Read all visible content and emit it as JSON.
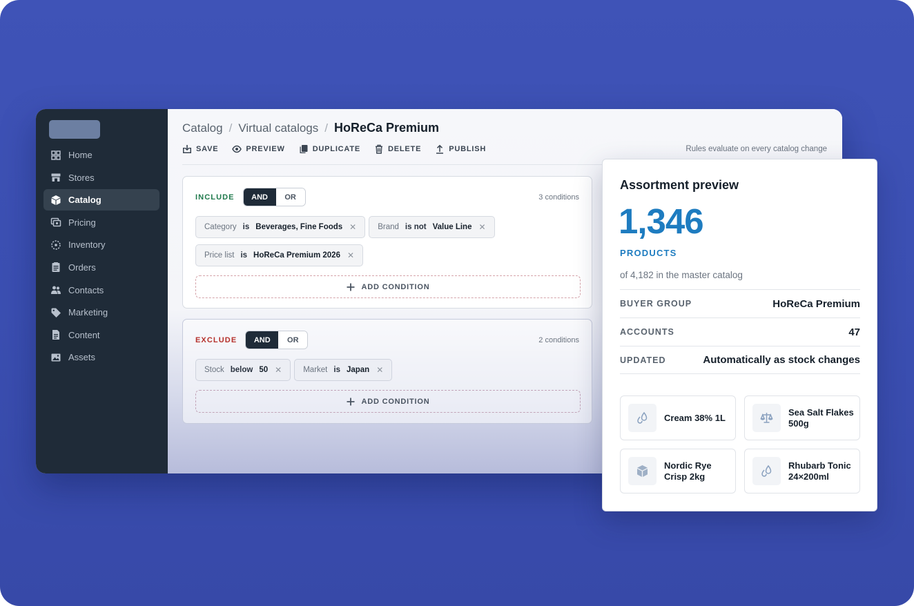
{
  "sidebar": {
    "items": [
      {
        "label": "Home",
        "icon": "grid-icon"
      },
      {
        "label": "Stores",
        "icon": "store-icon"
      },
      {
        "label": "Catalog",
        "icon": "box-icon",
        "active": true
      },
      {
        "label": "Pricing",
        "icon": "pricing-icon"
      },
      {
        "label": "Inventory",
        "icon": "inventory-icon"
      },
      {
        "label": "Orders",
        "icon": "clipboard-icon"
      },
      {
        "label": "Contacts",
        "icon": "people-icon"
      },
      {
        "label": "Marketing",
        "icon": "tag-icon"
      },
      {
        "label": "Content",
        "icon": "document-icon"
      },
      {
        "label": "Assets",
        "icon": "image-icon"
      }
    ]
  },
  "breadcrumb": {
    "root": "Catalog",
    "parent": "Virtual catalogs",
    "current": "HoReCa Premium"
  },
  "toolbar": {
    "save": "SAVE",
    "preview": "PREVIEW",
    "duplicate": "DUPLICATE",
    "delete": "DELETE",
    "publish": "PUBLISH",
    "note": "Rules evaluate on every catalog change"
  },
  "include": {
    "label": "INCLUDE",
    "and": "AND",
    "or": "OR",
    "count": "3 conditions",
    "conditions": [
      {
        "field": "Category",
        "op": "is",
        "value": "Beverages, Fine Foods"
      },
      {
        "field": "Brand",
        "op": "is not",
        "value": "Value Line"
      },
      {
        "field": "Price list",
        "op": "is",
        "value": "HoReCa Premium 2026"
      }
    ],
    "add": "ADD CONDITION"
  },
  "exclude": {
    "label": "EXCLUDE",
    "and": "AND",
    "or": "OR",
    "count": "2 conditions",
    "conditions": [
      {
        "field": "Stock",
        "op": "below",
        "value": "50"
      },
      {
        "field": "Market",
        "op": "is",
        "value": "Japan"
      }
    ],
    "add": "ADD CONDITION"
  },
  "preview": {
    "title": "Assortment preview",
    "count": "1,346",
    "unit": "PRODUCTS",
    "sub": "of 4,182 in the master catalog",
    "rows": [
      {
        "key": "BUYER GROUP",
        "value": "HoReCa Premium"
      },
      {
        "key": "ACCOUNTS",
        "value": "47"
      },
      {
        "key": "UPDATED",
        "value": "Automatically as stock changes"
      }
    ],
    "products": [
      {
        "name": "Cream 38% 1L",
        "icon": "droplet-icon"
      },
      {
        "name": "Sea Salt Flakes 500g",
        "icon": "scale-icon"
      },
      {
        "name": "Nordic Rye Crisp 2kg",
        "icon": "box-icon"
      },
      {
        "name": "Rhubarb Tonic 24×200ml",
        "icon": "droplet-icon"
      }
    ]
  },
  "colors": {
    "background": "#3f53b7",
    "sidebar": "#1f2b38",
    "include_label": "#1f7a4c",
    "exclude_label": "#b5302b",
    "accent": "#1e7cc0"
  }
}
